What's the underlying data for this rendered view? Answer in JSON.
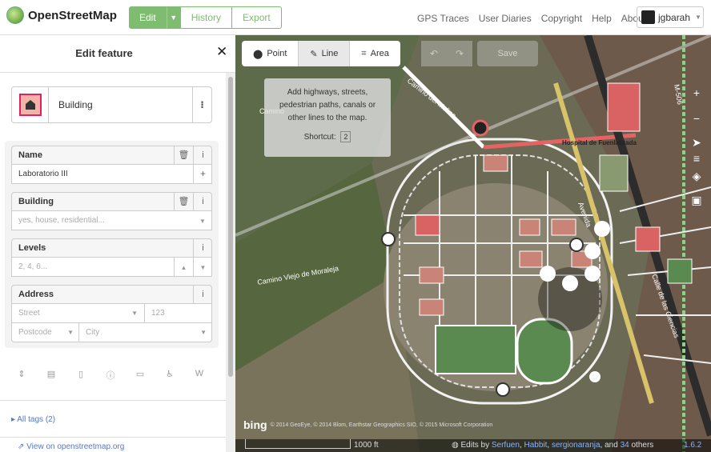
{
  "app": {
    "name": "OpenStreetMap"
  },
  "header": {
    "edit_label": "Edit",
    "history_label": "History",
    "export_label": "Export",
    "nav": [
      "GPS Traces",
      "User Diaries",
      "Copyright",
      "Help",
      "About"
    ],
    "user": "jgbarah"
  },
  "sidebar": {
    "title": "Edit feature",
    "preset": {
      "name": "Building"
    },
    "fields": {
      "name": {
        "label": "Name",
        "value": "Laboratorio III"
      },
      "building": {
        "label": "Building",
        "placeholder": "yes, house, residential..."
      },
      "levels": {
        "label": "Levels",
        "placeholder": "2, 4, 6..."
      },
      "address": {
        "label": "Address",
        "street_placeholder": "Street",
        "number_value": "123",
        "postcode_placeholder": "Postcode",
        "city_placeholder": "City"
      }
    },
    "all_tags": "All tags (2)",
    "view_on_osm": "View on openstreetmap.org"
  },
  "map": {
    "modes": [
      "Point",
      "Line",
      "Area"
    ],
    "save_label": "Save",
    "tooltip": {
      "text": "Add highways, streets, pedestrian paths, canals or other lines to the map.",
      "shortcut_label": "Shortcut:",
      "shortcut_key": "2"
    },
    "labels": {
      "street1": "Camino del Molino",
      "street2": "Camino Viejo de Moraleja",
      "hospital": "Hospital de Fuenlabrada",
      "avenida": "Avenida",
      "calle": "Calle de las Ciencias",
      "m506": "M-506",
      "camino_left": "Camino"
    },
    "attribution": {
      "bing": "bing",
      "text": "© 2014 GeoEye, © 2014 Blom, Earthstar Geographics SIO, © 2015 Microsoft Corporation"
    },
    "scale_label": "1000 ft",
    "edits_prefix": "Edits by",
    "editors": [
      "Serfuen",
      "Habbit",
      "sergionaranja"
    ],
    "edits_suffix_and": "and",
    "others_count": "34",
    "edits_suffix_others": "others",
    "version": "1.6.2"
  },
  "colors": {
    "osm_green": "#7ebc6f",
    "building_fill": "#f4b2a8",
    "link_blue": "#5578c5"
  }
}
